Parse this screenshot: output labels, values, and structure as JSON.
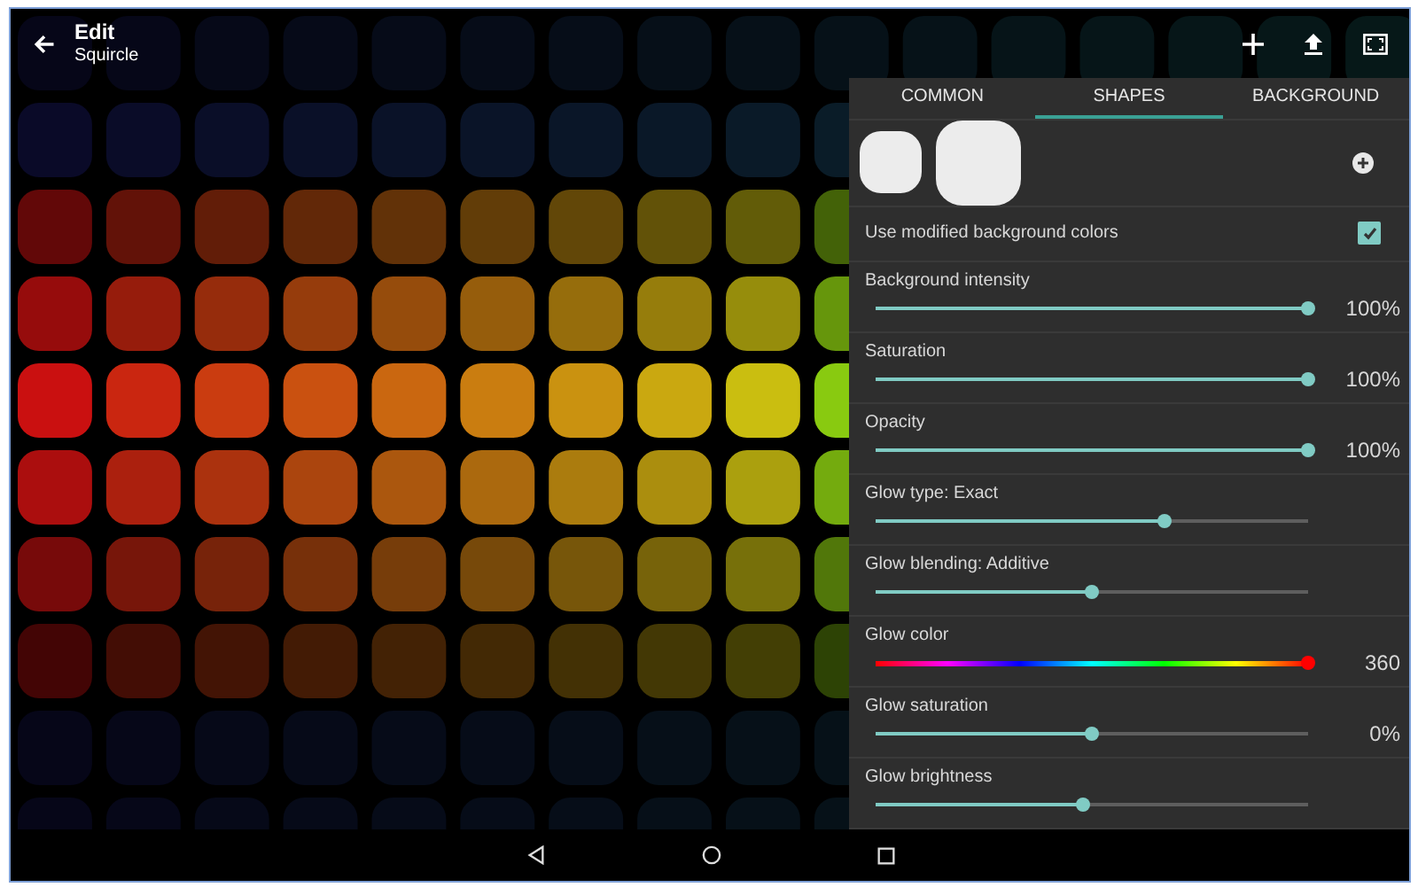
{
  "app_bar": {
    "title": "Edit",
    "subtitle": "Squircle"
  },
  "tabs": [
    {
      "label": "COMMON",
      "selected": false
    },
    {
      "label": "SHAPES",
      "selected": true
    },
    {
      "label": "BACKGROUND",
      "selected": false
    }
  ],
  "use_modified_colors": {
    "label": "Use modified background colors",
    "checked": true
  },
  "settings": [
    {
      "kind": "slider",
      "label": "Background intensity",
      "level": 1.0,
      "reading": "100%"
    },
    {
      "kind": "slider",
      "label": "Saturation",
      "level": 1.0,
      "reading": "100%"
    },
    {
      "kind": "slider",
      "label": "Opacity",
      "level": 1.0,
      "reading": "100%"
    },
    {
      "kind": "slider",
      "label": "Glow type: Exact",
      "level": 0.67
    },
    {
      "kind": "slider",
      "label": "Glow blending: Additive",
      "level": 0.5
    },
    {
      "kind": "hue",
      "label": "Glow color",
      "level": 1.0,
      "reading": "360"
    },
    {
      "kind": "slider",
      "label": "Glow saturation",
      "level": 0.5,
      "reading": "0%"
    },
    {
      "kind": "slider",
      "label": "Glow brightness",
      "level": 0.48
    }
  ]
}
